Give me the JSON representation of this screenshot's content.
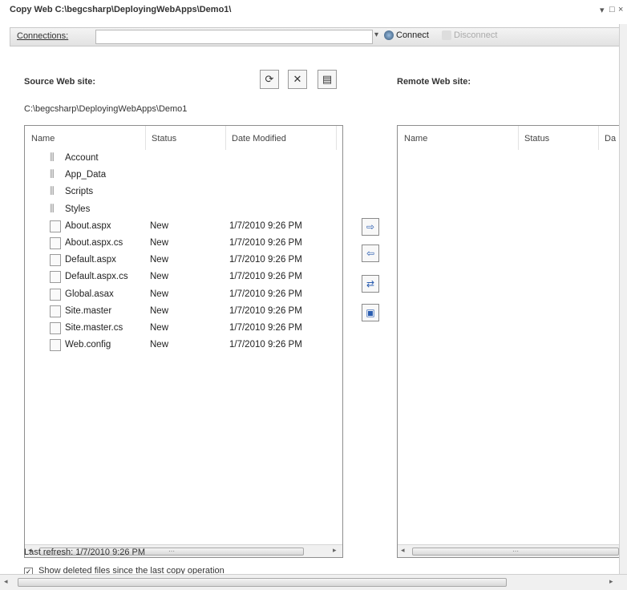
{
  "window": {
    "title": "Copy Web C:\\begcsharp\\DeployingWebApps\\Demo1\\",
    "controls": [
      "▾",
      "□",
      "×"
    ]
  },
  "toolbar": {
    "connections_label": "Connections:",
    "connections_value": "",
    "connect_label": "Connect",
    "disconnect_label": "Disconnect"
  },
  "source": {
    "label": "Source Web site:",
    "path": "C:\\begcsharp\\DeployingWebApps\\Demo1",
    "columns": [
      "Name",
      "Status",
      "Date Modified"
    ],
    "rows": [
      {
        "name": "Account",
        "status": "",
        "date": "",
        "type": "folder"
      },
      {
        "name": "App_Data",
        "status": "",
        "date": "",
        "type": "folder"
      },
      {
        "name": "Scripts",
        "status": "",
        "date": "",
        "type": "folder"
      },
      {
        "name": "Styles",
        "status": "",
        "date": "",
        "type": "folder"
      },
      {
        "name": "About.aspx",
        "status": "New",
        "date": "1/7/2010 9:26 PM",
        "type": "file"
      },
      {
        "name": "About.aspx.cs",
        "status": "New",
        "date": "1/7/2010 9:26 PM",
        "type": "file"
      },
      {
        "name": "Default.aspx",
        "status": "New",
        "date": "1/7/2010 9:26 PM",
        "type": "file"
      },
      {
        "name": "Default.aspx.cs",
        "status": "New",
        "date": "1/7/2010 9:26 PM",
        "type": "file"
      },
      {
        "name": "Global.asax",
        "status": "New",
        "date": "1/7/2010 9:26 PM",
        "type": "file"
      },
      {
        "name": "Site.master",
        "status": "New",
        "date": "1/7/2010 9:26 PM",
        "type": "file"
      },
      {
        "name": "Site.master.cs",
        "status": "New",
        "date": "1/7/2010 9:26 PM",
        "type": "file"
      },
      {
        "name": "Web.config",
        "status": "New",
        "date": "1/7/2010 9:26 PM",
        "type": "file"
      }
    ]
  },
  "remote": {
    "label": "Remote Web site:",
    "columns": [
      "Name",
      "Status",
      "Da"
    ]
  },
  "footer": {
    "last_refresh": "Last refresh: 1/7/2010 9:26 PM",
    "show_deleted": "Show deleted files since the last copy operation"
  },
  "colors": {
    "border": "#8e8e8e",
    "accent": "#2a5db0"
  }
}
